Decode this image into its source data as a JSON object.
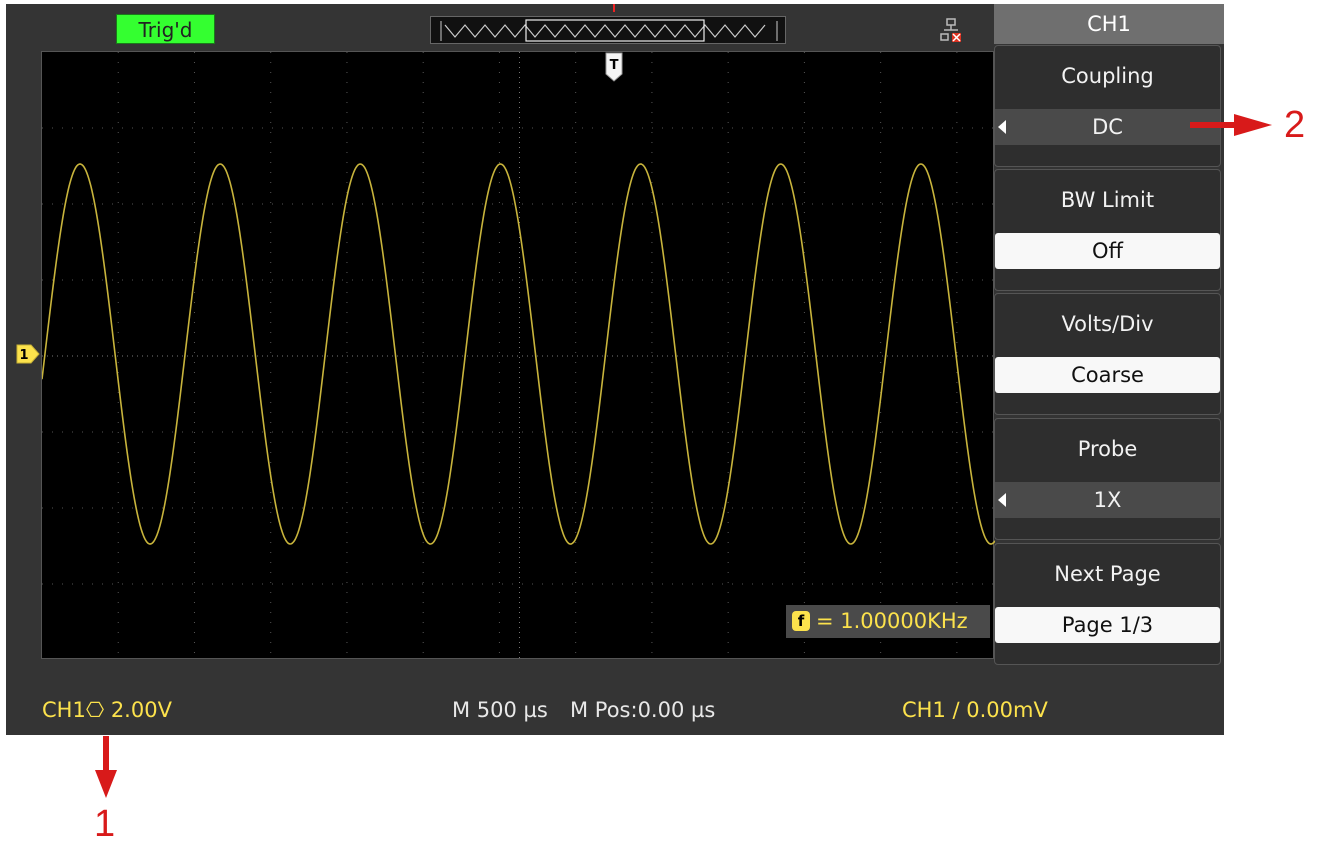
{
  "status_top": {
    "trigger_state": "Trig'd",
    "trigger_color": "#34ff30"
  },
  "menu": {
    "header": "CH1",
    "items": [
      {
        "label": "Coupling",
        "value": "DC",
        "selected_style": "dark",
        "has_arrow": true
      },
      {
        "label": "BW Limit",
        "value": "Off",
        "selected_style": "light",
        "has_arrow": false
      },
      {
        "label": "Volts/Div",
        "value": "Coarse",
        "selected_style": "light",
        "has_arrow": false
      },
      {
        "label": "Probe",
        "value": "1X",
        "selected_style": "dark",
        "has_arrow": true
      },
      {
        "label": "Next Page",
        "value": "Page 1/3",
        "selected_style": "light",
        "has_arrow": false
      }
    ]
  },
  "waveform": {
    "channel_color": "#c8b43c",
    "cycles_visible": 6.8,
    "frequency_readout": "= 1.00000KHz",
    "frequency_icon": "f"
  },
  "markers": {
    "trigger_position": "T",
    "channel_level": "1"
  },
  "status_bottom": {
    "channel_scale": "CH1⎔ 2.00V",
    "timebase": "M 500 µs",
    "horizontal_position": "M Pos:0.00 µs",
    "trigger_info": "CH1 ∕ 0.00mV"
  },
  "annotations": {
    "label_1": "1",
    "label_2": "2",
    "color": "#d81a1a"
  },
  "icons": {
    "network": "network-disconnected-icon"
  }
}
